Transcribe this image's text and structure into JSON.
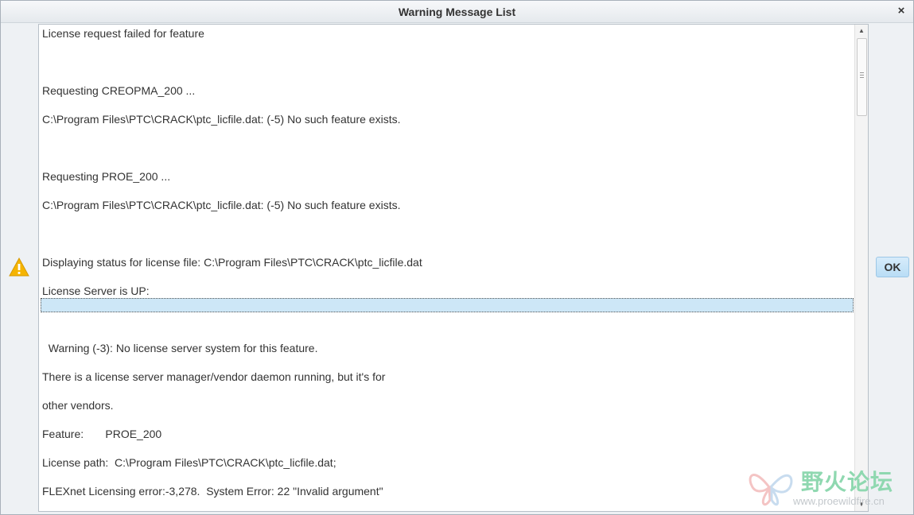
{
  "window": {
    "title": "Warning Message List",
    "close_glyph": "×"
  },
  "messages": [
    "License request failed for feature",
    "",
    "Requesting CREOPMA_200 ...",
    "C:\\Program Files\\PTC\\CRACK\\ptc_licfile.dat: (-5) No such feature exists.",
    "",
    "Requesting PROE_200 ...",
    "C:\\Program Files\\PTC\\CRACK\\ptc_licfile.dat: (-5) No such feature exists.",
    "",
    "Displaying status for license file: C:\\Program Files\\PTC\\CRACK\\ptc_licfile.dat",
    "License Server is UP:",
    "",
    "  Warning (-3): No license server system for this feature.",
    "There is a license server manager/vendor daemon running, but it's for",
    "other vendors.",
    "Feature:       PROE_200",
    "License path:  C:\\Program Files\\PTC\\CRACK\\ptc_licfile.dat;",
    "FLEXnet Licensing error:-3,278.  System Error: 22 \"Invalid argument\""
  ],
  "buttons": {
    "ok": "OK"
  },
  "icons": {
    "warning": "warning-triangle-icon",
    "close": "close-icon"
  },
  "watermark": {
    "name": "野火论坛",
    "url": "www.proewildfire.cn"
  },
  "colors": {
    "selection": "#cde7f7",
    "ok_button": "#c6e4f8",
    "warning": "#f5b400"
  }
}
